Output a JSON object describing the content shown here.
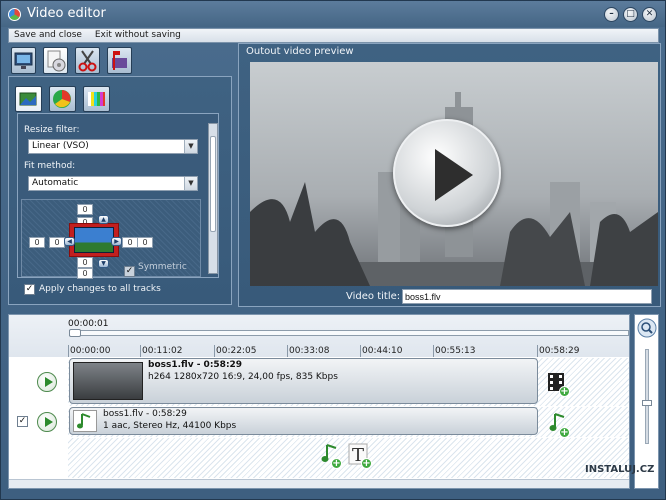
{
  "window": {
    "title": "Video editor",
    "controls": [
      "minimize-icon",
      "maximize-icon",
      "close-icon"
    ]
  },
  "menubar": {
    "items": [
      "Save and close",
      "Exit without saving"
    ]
  },
  "toolbar": {
    "buttons": [
      "monitor-settings-icon",
      "disc-settings-icon",
      "scissors-icon",
      "trim-icon"
    ]
  },
  "video_settings": {
    "tabs": [
      "resize-icon",
      "color-wheel-icon",
      "color-bars-icon"
    ],
    "resize_filter_label": "Resize filter:",
    "resize_filter_value": "Linear (VSO)",
    "fit_method_label": "Fit method:",
    "fit_method_value": "Automatic",
    "crop_values": {
      "top": "0",
      "left": "0",
      "right": "0",
      "bottom": "0",
      "inner_top": "0",
      "inner_left": "0",
      "inner_right": "0",
      "inner_bottom": "0"
    },
    "symmetric_label": "Symmetric",
    "apply_all_label": "Apply changes to all tracks",
    "apply_all_checked": true
  },
  "preview": {
    "label": "Outout video preview",
    "video_title_label": "Video title:",
    "video_title_value": "boss1.flv"
  },
  "timeline": {
    "cursor_time": "00:00:01",
    "ticks": [
      "00:00:00",
      "00:11:02",
      "00:22:05",
      "00:33:08",
      "00:44:10",
      "00:55:13",
      "00:58:29"
    ],
    "video_clip": {
      "name": "boss1.flv - 0:58:29",
      "info": "h264 1280x720 16:9, 24,00 fps, 835 Kbps"
    },
    "audio_clip": {
      "name": "boss1.flv - 0:58:29",
      "info": "1 aac, Stereo Hz, 44100 Kbps",
      "checked": true
    }
  },
  "watermark": "INSTALUJ.CZ",
  "colors": {
    "frame": "#3f6282",
    "accent_green": "#3fa93f"
  }
}
